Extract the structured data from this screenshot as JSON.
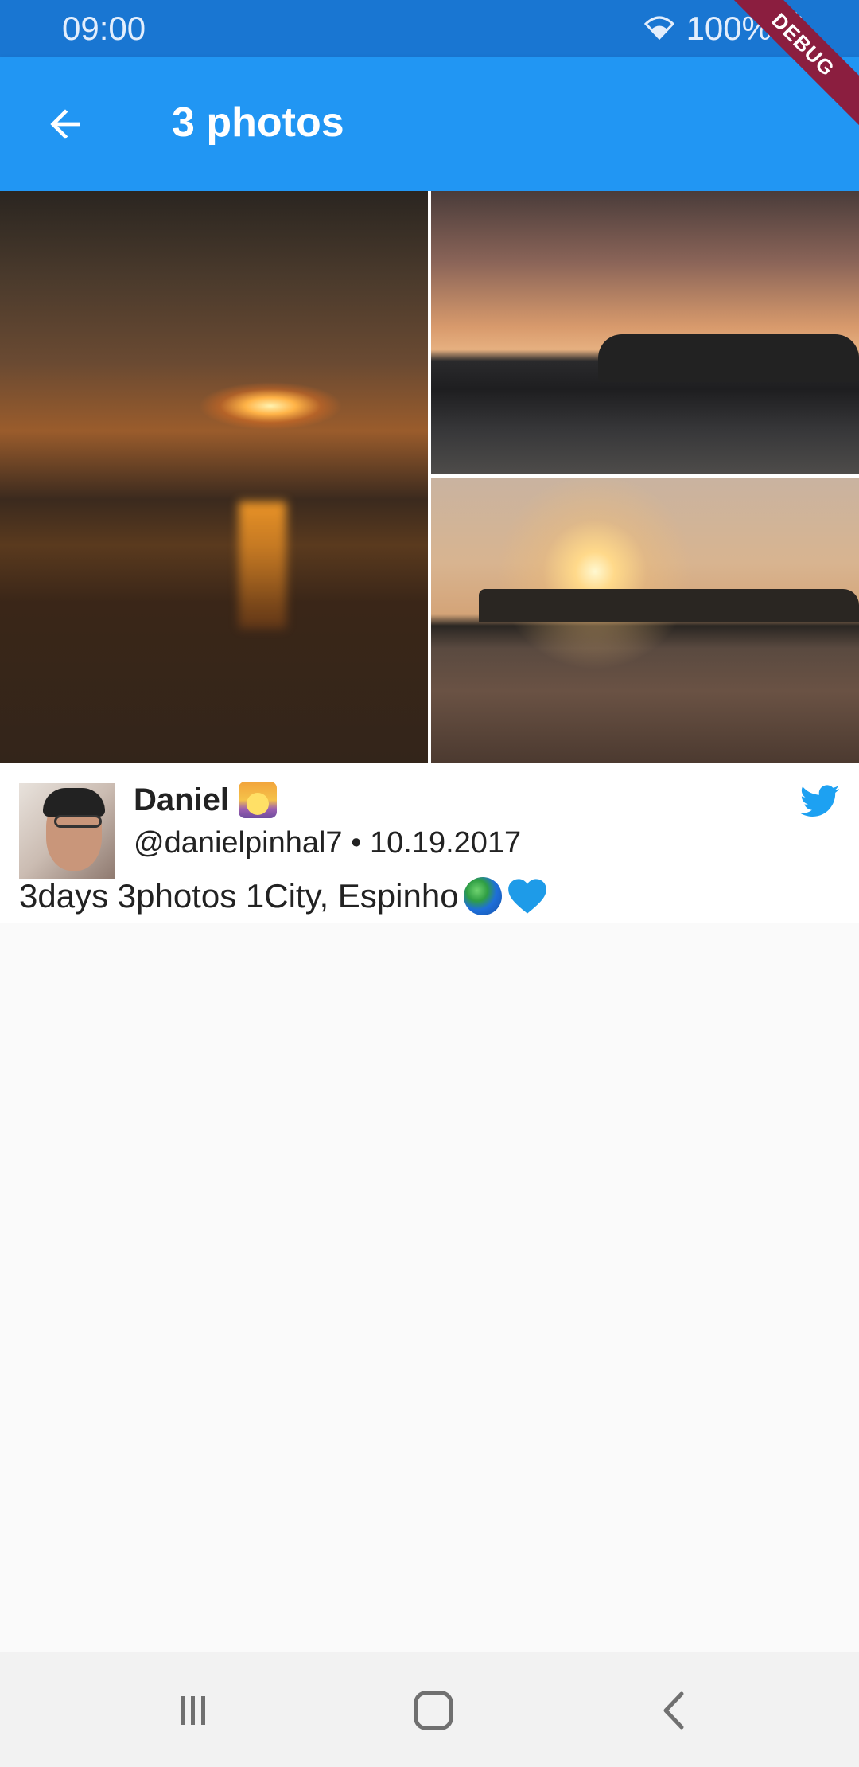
{
  "status_bar": {
    "time": "09:00",
    "battery": "100%",
    "wifi_icon": "wifi-icon",
    "battery_icon": "battery-icon"
  },
  "debug_banner": "DEBUG",
  "app_bar": {
    "title": "3 photos",
    "back_icon": "arrow-back-icon"
  },
  "photos": [
    {
      "name": "photo-sunset-beach"
    },
    {
      "name": "photo-fisherman-rocks"
    },
    {
      "name": "photo-sunset-jetty"
    }
  ],
  "tweet": {
    "author_name": "Daniel",
    "author_emoji": "sunrise-icon",
    "handle": "@danielpinhal7",
    "separator": "•",
    "date": "10.19.2017",
    "text": "3days 3photos 1City, Espinho",
    "text_emojis": [
      "globe-icon",
      "blue-heart-icon"
    ],
    "source_icon": "twitter-icon",
    "colors": {
      "twitter_blue": "#1da1f2"
    }
  },
  "nav_bar": {
    "recent_apps_icon": "recent-apps-icon",
    "home_icon": "home-icon",
    "back_icon": "nav-back-icon"
  },
  "colors": {
    "app_bar": "#2196f3",
    "status_bar": "#1976d2",
    "debug_ribbon": "#8b1e3f",
    "background": "#fafafa"
  }
}
